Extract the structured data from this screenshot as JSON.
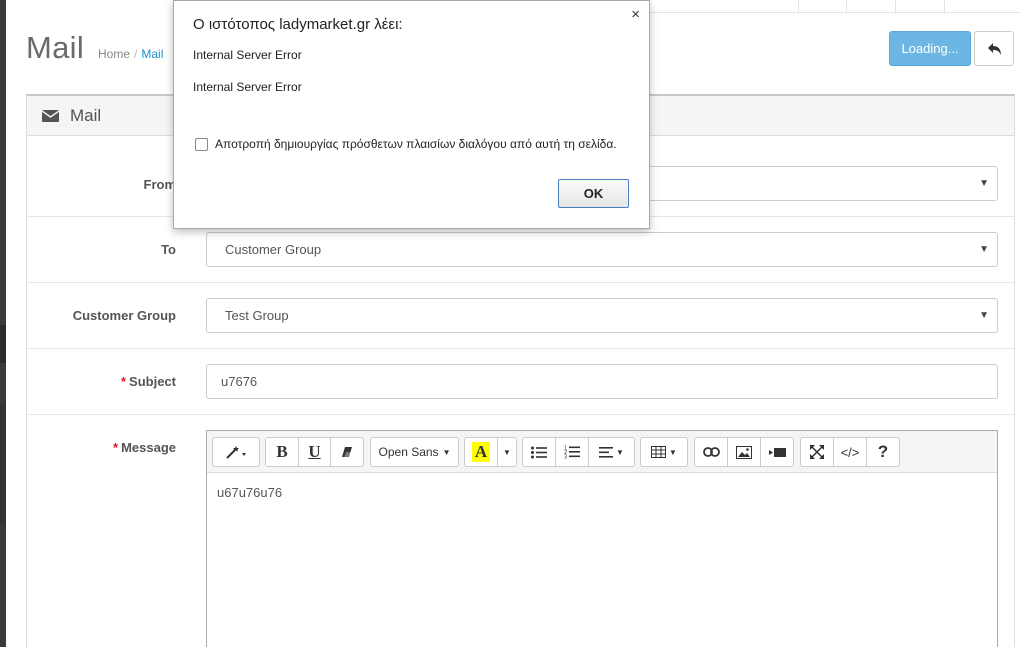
{
  "page": {
    "title": "Mail",
    "breadcrumb": [
      "Home",
      "Mail"
    ],
    "save_button_label": "Loading...",
    "back_button_icon": "reply-icon"
  },
  "panel": {
    "icon": "envelope-icon",
    "title": "Mail"
  },
  "form": {
    "from": {
      "label": "From",
      "value": ""
    },
    "to": {
      "label": "To",
      "value": "Customer Group"
    },
    "customer_group": {
      "label": "Customer Group",
      "value": "Test Group"
    },
    "subject": {
      "label": "Subject",
      "required_marker": "*",
      "value": "u7676"
    },
    "message": {
      "label": "Message",
      "required_marker": "*",
      "value": "u67u76u76"
    }
  },
  "editor_toolbar": {
    "font_name": "Open Sans",
    "bold": "B",
    "underline": "U",
    "color_letter": "A",
    "help": "?",
    "code": "</>",
    "colors": {
      "highlight": "#ffff00"
    }
  },
  "dialog": {
    "title": "Ο ιστότοπος ladymarket.gr λέει:",
    "close": "×",
    "message_1": "Internal Server Error",
    "message_2": "Internal Server Error",
    "checkbox_label": "Αποτροπή δημιουργίας πρόσθετων πλαισίων διαλόγου από αυτή τη σελίδα.",
    "ok_label": "OK"
  },
  "colors": {
    "accent": "#1e91cf",
    "loading_button": "#6bb6e2",
    "required": "#e01a1a"
  }
}
